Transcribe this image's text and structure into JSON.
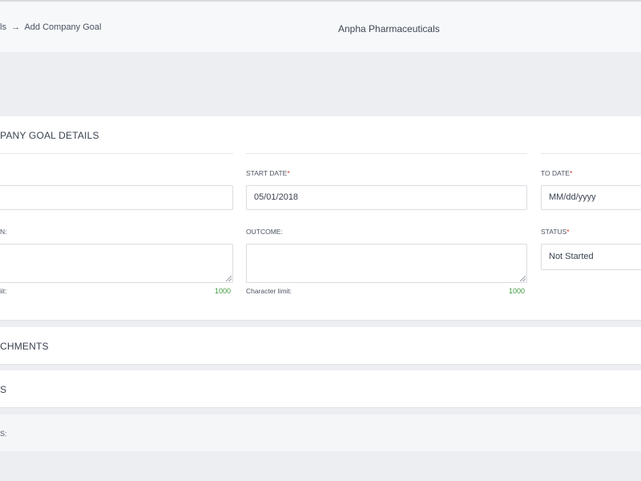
{
  "header": {
    "breadcrumb_prev": "ls",
    "breadcrumb_arrow": "→",
    "breadcrumb_current": "Add Company Goal",
    "company_name": "Anpha Pharmaceuticals"
  },
  "details": {
    "title": "PANY GOAL DETAILS",
    "start_date": {
      "label": "START DATE",
      "required_mark": "*",
      "value": "05/01/2018"
    },
    "to_date": {
      "label": "TO DATE",
      "required_mark": "*",
      "placeholder": "MM/dd/yyyy"
    },
    "left_textarea": {
      "label": "N:",
      "limit_label": "iit:",
      "limit_value": "1000"
    },
    "outcome": {
      "label": "OUTCOME:",
      "limit_label": "Character limit:",
      "limit_value": "1000"
    },
    "status": {
      "label": "STATUS",
      "required_mark": "*",
      "value": "Not Started"
    }
  },
  "sections": {
    "attachments_title": "CHMENTS",
    "second_title": "S",
    "third_title": "S:"
  },
  "colors": {
    "required": "#d9342b",
    "limit_count": "#3c9a3c",
    "page_background": "#eceef1"
  }
}
